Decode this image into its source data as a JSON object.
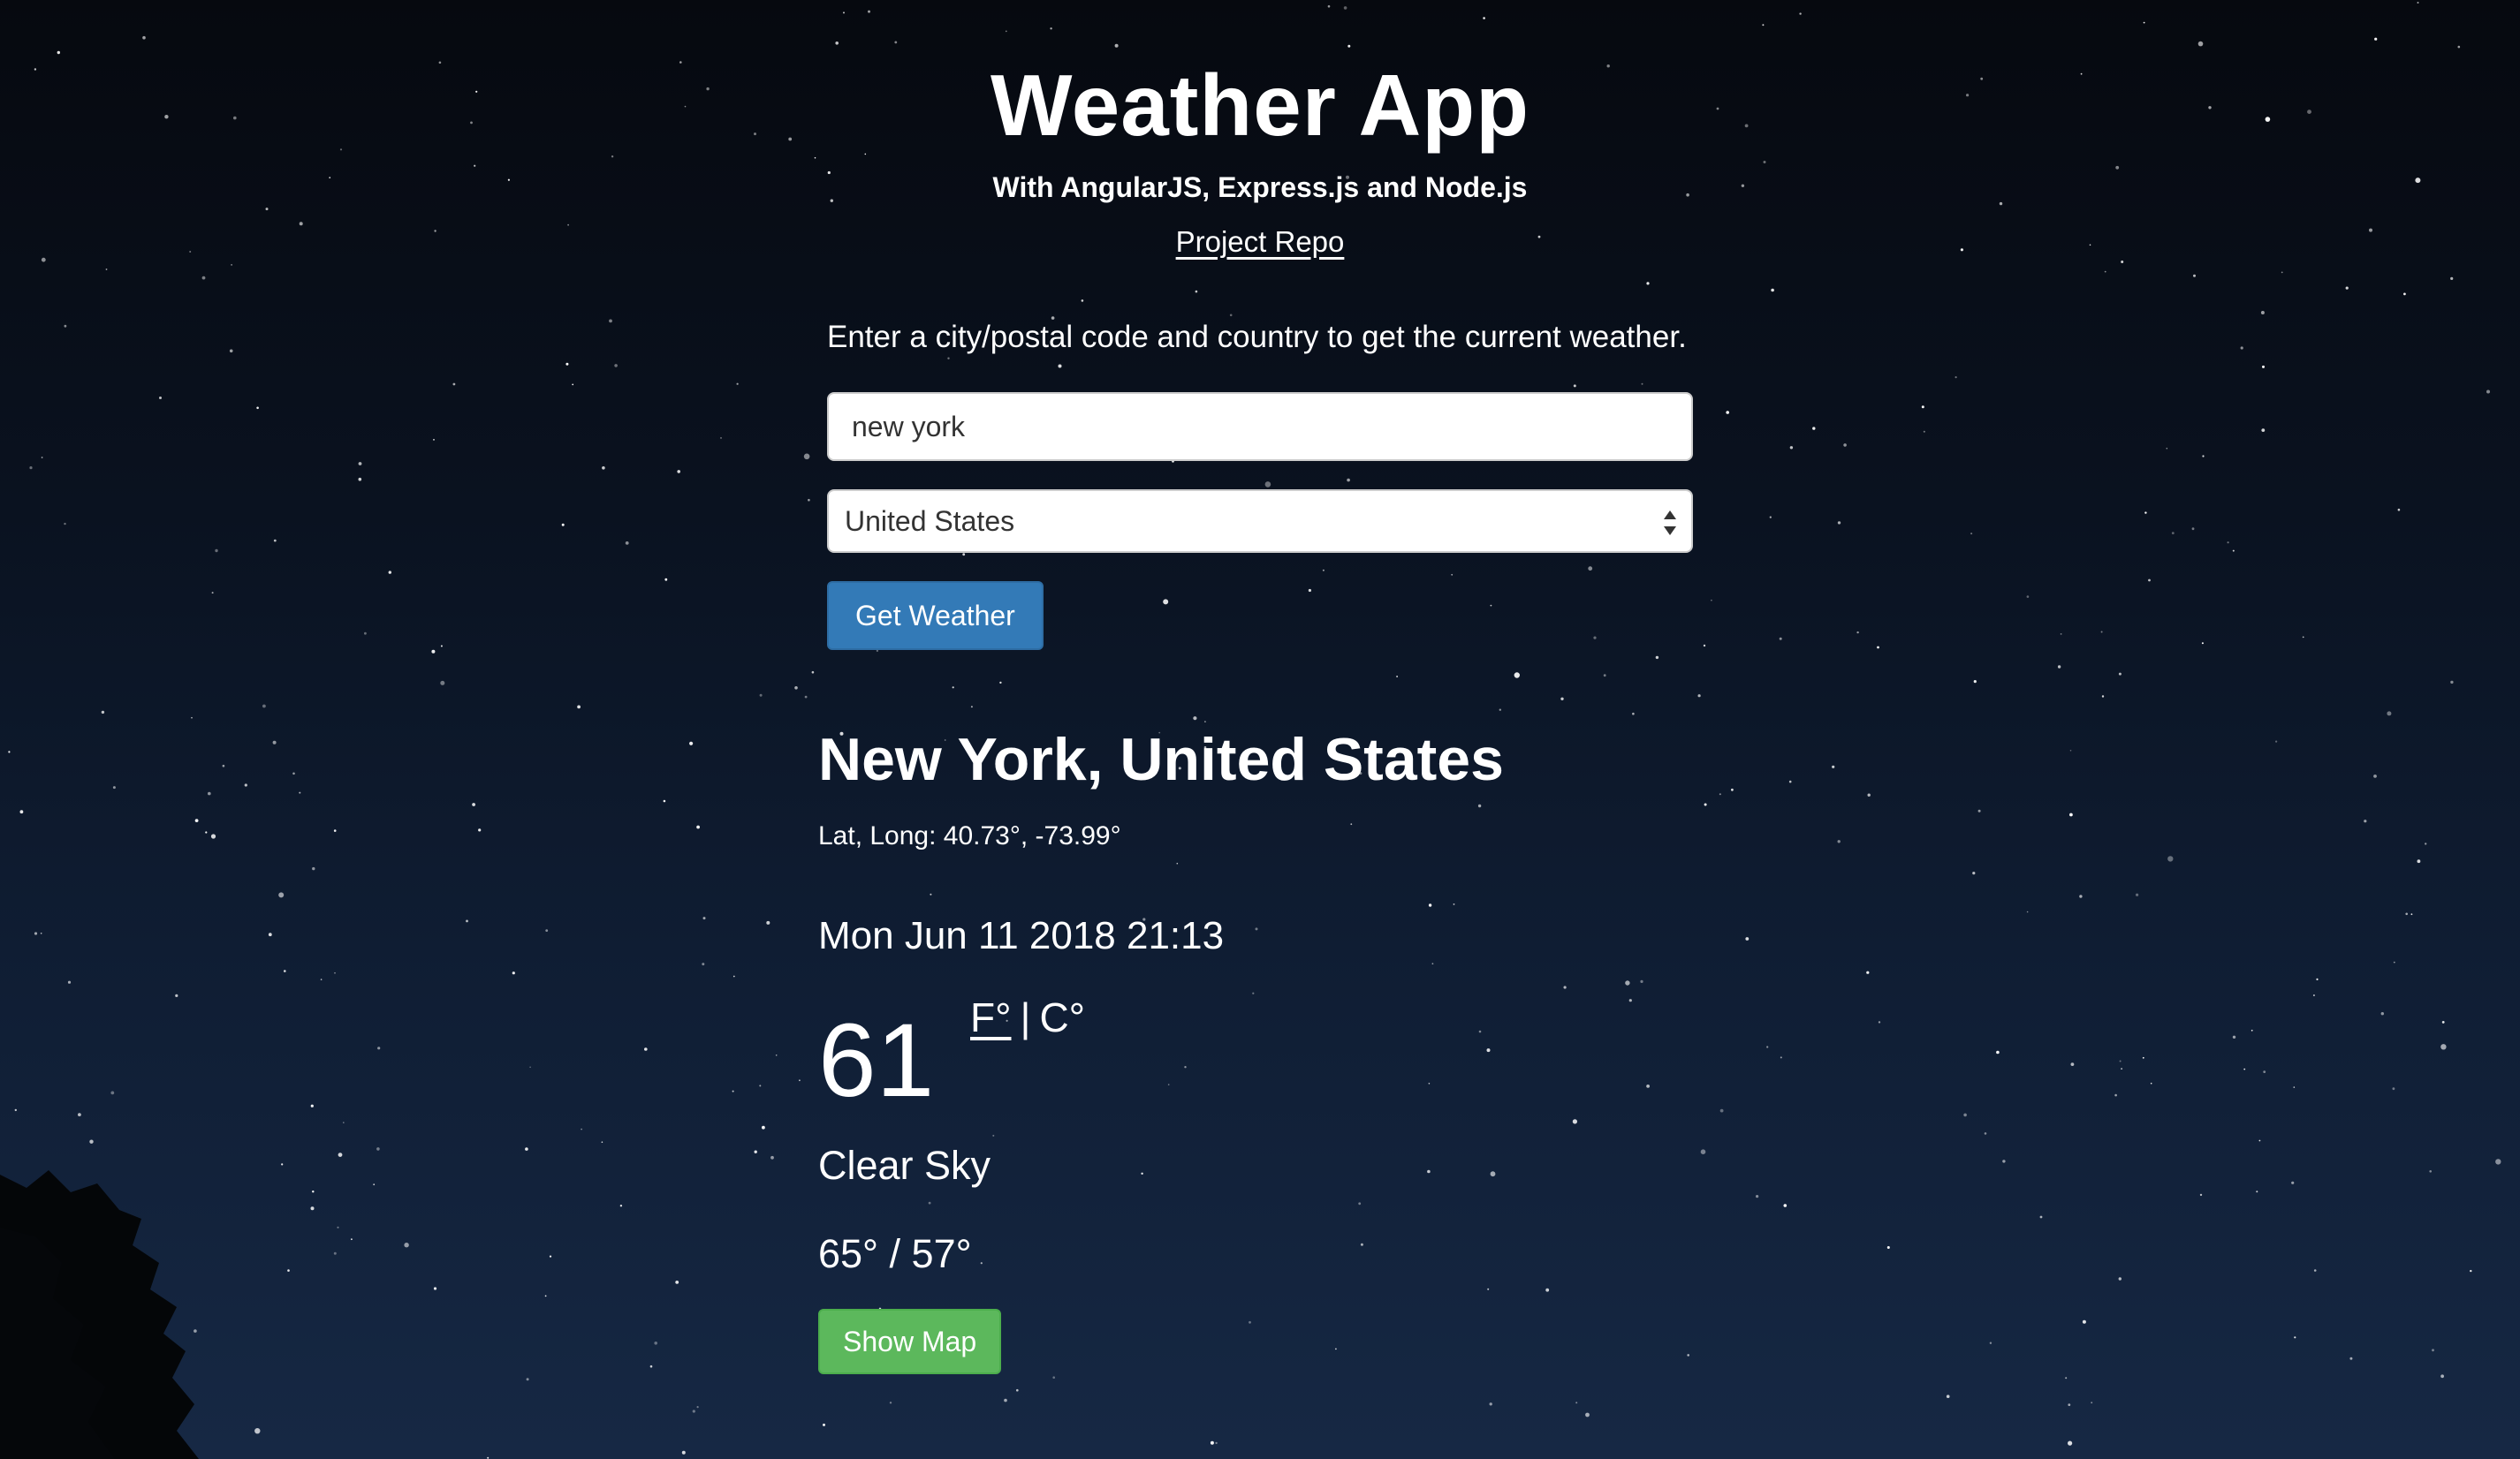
{
  "header": {
    "title": "Weather App",
    "subtitle": "With AngularJS, Express.js and Node.js",
    "repo_link": "Project Repo"
  },
  "form": {
    "instructions": "Enter a city/postal code and country to get the current weather.",
    "city_value": "new york",
    "country_selected": "United States",
    "submit_label": "Get Weather"
  },
  "result": {
    "location": "New York, United States",
    "latlong": "Lat, Long: 40.73°, -73.99°",
    "datetime": "Mon Jun 11 2018 21:13",
    "temperature": "61",
    "unit_f": "F°",
    "unit_separator": "|",
    "unit_c": "C°",
    "condition": "Clear Sky",
    "high_low": "65° / 57°",
    "map_button_label": "Show Map"
  },
  "colors": {
    "primary_button": "#337ab7",
    "success_button": "#5cb85c",
    "background_top": "#06090f",
    "background_bottom": "#162844"
  },
  "icons": {
    "select_arrows": "updown-arrows-icon"
  }
}
